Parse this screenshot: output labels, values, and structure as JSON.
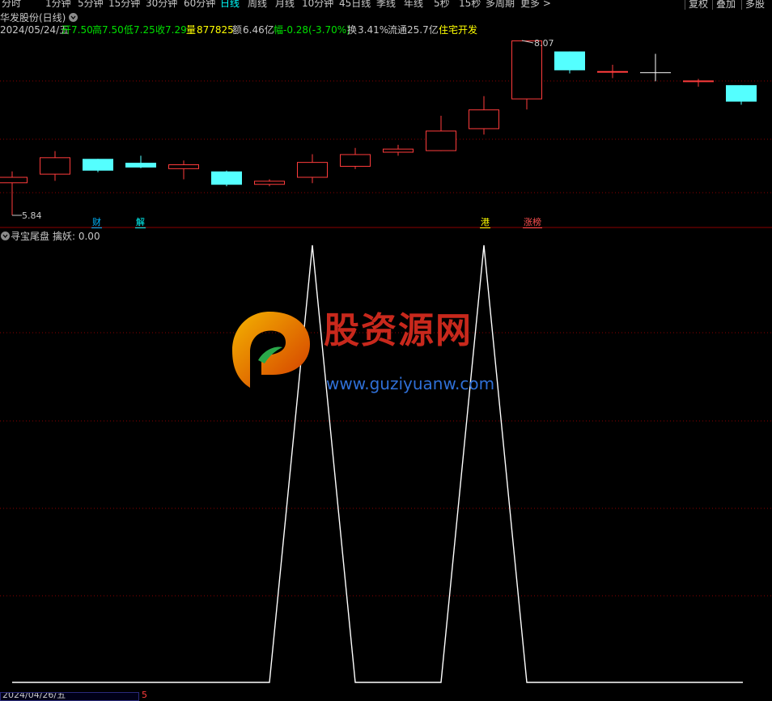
{
  "toolbar": {
    "periods": [
      "分时",
      "1分钟",
      "5分钟",
      "15分钟",
      "30分钟",
      "60分钟",
      "日线",
      "周线",
      "月线",
      "10分钟",
      "45日线",
      "季线",
      "年线",
      "5秒",
      "15秒",
      "多周期",
      "更多 >"
    ],
    "active_period": "日线",
    "buttons": [
      "复权",
      "叠加",
      "多股"
    ]
  },
  "stock": {
    "title": "华发股份(日线)",
    "date": "2024/05/24/五",
    "open_label": "开",
    "open": "7.50",
    "high_label": "高",
    "high": "7.50",
    "low_label": "低",
    "low": "7.25",
    "close_label": "收",
    "close": "7.29",
    "volume_label": "量",
    "volume": "877825",
    "amount_label": "额",
    "amount": "6.46亿",
    "change_label": "幅",
    "change": "-0.28(-3.70%)",
    "turnover_label": "换",
    "turnover": "3.41%",
    "float_label": "流通",
    "float": "25.7亿",
    "sector": "住宅开发"
  },
  "price_chart": {
    "max_label": "8.07",
    "min_label": "5.84",
    "markers": [
      {
        "text": "财",
        "color": "#00b7ff"
      },
      {
        "text": "解",
        "color": "#00ffff"
      },
      {
        "text": "港",
        "color": "#ffff00"
      },
      {
        "text": "涨榜",
        "color": "#ff5050"
      }
    ]
  },
  "indicator": {
    "name": "寻宝尾盘",
    "line_label": "擒妖: 0.00"
  },
  "watermark": {
    "brand": "股资源网",
    "url": "www.guziyuanw.com"
  },
  "footer": {
    "date": "2024/04/26/五",
    "mark": "5"
  },
  "colors": {
    "up": "#ff3c3c",
    "down": "#54ffff",
    "doji": "#ffffff",
    "grid": "#8b0000",
    "indicator_line": "#ffffff"
  },
  "chart_data": [
    {
      "type": "candlestick",
      "title": "华发股份(日线)",
      "series": [
        {
          "o": 6.25,
          "c": 6.33,
          "h": 6.4,
          "l": 5.84
        },
        {
          "o": 6.36,
          "c": 6.58,
          "h": 6.66,
          "l": 6.28
        },
        {
          "o": 6.56,
          "c": 6.41,
          "h": 6.56,
          "l": 6.39
        },
        {
          "o": 6.51,
          "c": 6.45,
          "h": 6.6,
          "l": 6.44
        },
        {
          "o": 6.43,
          "c": 6.49,
          "h": 6.54,
          "l": 6.3
        },
        {
          "o": 6.4,
          "c": 6.23,
          "h": 6.41,
          "l": 6.21
        },
        {
          "o": 6.23,
          "c": 6.28,
          "h": 6.3,
          "l": 6.21
        },
        {
          "o": 6.32,
          "c": 6.52,
          "h": 6.62,
          "l": 6.25
        },
        {
          "o": 6.46,
          "c": 6.62,
          "h": 6.7,
          "l": 6.43
        },
        {
          "o": 6.64,
          "c": 6.69,
          "h": 6.74,
          "l": 6.6
        },
        {
          "o": 6.66,
          "c": 6.92,
          "h": 7.11,
          "l": 6.66
        },
        {
          "o": 6.94,
          "c": 7.19,
          "h": 7.36,
          "l": 6.87
        },
        {
          "o": 7.32,
          "c": 8.07,
          "h": 8.07,
          "l": 7.19
        },
        {
          "o": 7.93,
          "c": 7.69,
          "h": 7.93,
          "l": 7.65
        },
        {
          "o": 7.66,
          "c": 7.68,
          "h": 7.76,
          "l": 7.59
        },
        {
          "o": 7.66,
          "c": 7.66,
          "h": 7.9,
          "l": 7.55
        },
        {
          "o": 7.55,
          "c": 7.56,
          "h": 7.58,
          "l": 7.48
        },
        {
          "o": 7.5,
          "c": 7.29,
          "h": 7.5,
          "l": 7.25
        }
      ]
    },
    {
      "type": "line",
      "name": "擒妖",
      "x_index": [
        0,
        6,
        7,
        8,
        9,
        10,
        11,
        12,
        13,
        17
      ],
      "values": [
        0,
        0,
        1,
        0,
        0,
        0,
        1,
        0,
        0,
        0
      ],
      "ylim": [
        0,
        1
      ]
    }
  ]
}
